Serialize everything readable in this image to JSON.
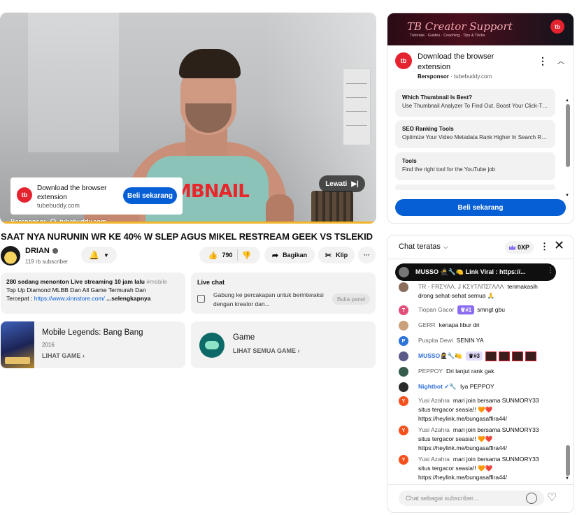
{
  "player": {
    "ad_title": "Download the browser extension",
    "ad_domain": "tubebuddy.com",
    "ad_button": "Beli sekarang",
    "ad_logo_text": "tb",
    "sponsored_label": "Bersponsor",
    "sponsored_domain": "tubebuddy.com",
    "skip_label": "Lewati",
    "tank_text": "MBNAIL",
    "progress_fraction": 1.0,
    "progress_color": "#f2b428"
  },
  "video": {
    "title": "SAAT NYA NURUNIN WR KE 40% W SLEP AGUS MIKEL RESTREAM GEEK VS TSLEKID",
    "channel_name": "DRIAN",
    "subscribers": "119 rb subscriber",
    "like_count": "790",
    "share_label": "Bagikan",
    "clip_label": "Klip",
    "more_label": "···"
  },
  "description": {
    "meta": "280 sedang menonton  Live streaming 10 jam lalu  ",
    "tag": "#mobile",
    "line2": "Top Up Diamond MLBB Dan All Game Termurah Dan",
    "line3_prefix": "Tercepat : ",
    "link": "https://www.xinnstore.com/",
    "more": "...selengkapnya"
  },
  "livechat_card": {
    "title": "Live chat",
    "text": "Gabung ke percakapan untuk berinteraksi dengan kreator dan...",
    "button": "Buka panel"
  },
  "game_card": {
    "name": "Mobile Legends: Bang Bang",
    "year": "2016",
    "link": "LIHAT GAME"
  },
  "category_card": {
    "name": "Game",
    "link": "LIHAT SEMUA GAME"
  },
  "ad_panel": {
    "banner_title": "TB Creator Support",
    "banner_sub": "Tutorials · Guides · Coaching · Tips & Tricks",
    "banner_badge": "tb",
    "logo_text": "tb",
    "title": "Download the browser extension",
    "sponsor": "Bersponsor",
    "domain": " · tubebuddy.com",
    "sitelinks": [
      {
        "title": "Which Thumbnail Is Best?",
        "desc": "Use Thumbnail Analyzer To Find Out. Boost Your Click-Th..."
      },
      {
        "title": "SEO Ranking Tools",
        "desc": "Optimize Your Video Metadata Rank Higher In Search Re..."
      },
      {
        "title": "Tools",
        "desc": "Find the right tool for the YouTube job"
      }
    ],
    "cta": "Beli sekarang"
  },
  "chat": {
    "title": "Chat teratas",
    "xp": "0XP",
    "pinned": "MUSSO 🥷🔧🍋   Link Viral : https://...",
    "messages": [
      {
        "author": "TR - FRΣΥΛΛ. J KΣΥΤΛΠΣΓΛΛΛ",
        "text": "terimakasih drong sehat-sehat semua 🙏",
        "avatar_color": "#8a6d5a",
        "avatar_letter": ""
      },
      {
        "author": "Tiopan Gacor",
        "badge": "#1",
        "text": "smngt gbu",
        "avatar_color": "#e24f7a",
        "avatar_letter": "T"
      },
      {
        "author": "GERR",
        "text": "kenapa libur dri",
        "avatar_color": "#c9a27c",
        "avatar_letter": ""
      },
      {
        "author": "Puspita Dewi",
        "text": "SENIN YA",
        "avatar_color": "#2e74d6",
        "avatar_letter": "P"
      },
      {
        "author": "MUSSO🥷🔧🍋",
        "badge": "#3",
        "text": "",
        "avatar_color": "#5b5b8a",
        "avatar_letter": ""
      },
      {
        "author": "PEPPOY",
        "text": "Dri lanjut rank gak",
        "avatar_color": "#355c4c",
        "avatar_letter": ""
      },
      {
        "author": "Nightbot ✓🔧",
        "text": "Iya PEPPOY",
        "avatar_color": "#2a2a2a",
        "avatar_letter": ""
      },
      {
        "author": "Yusi Azahra",
        "text": "mari join bersama SUNMORY33 situs tergacor seasia!! 🧡❤️ https://heylink.me/bungasaffira44/",
        "avatar_color": "#f4511e",
        "avatar_letter": "Y"
      },
      {
        "author": "Yusi Azahra",
        "text": "mari join bersama SUNMORY33 situs tergacor seasia!! 🧡❤️ https://heylink.me/bungasaffira44/",
        "avatar_color": "#f4511e",
        "avatar_letter": "Y"
      },
      {
        "author": "Yusi Azahra",
        "text": "mari join bersama SUNMORY33 situs tergacor seasia!! 🧡❤️ https://heylink.me/bungasaffira44/",
        "avatar_color": "#f4511e",
        "avatar_letter": "Y"
      }
    ],
    "input_placeholder": "Chat sebagai subscriber..."
  },
  "colors": {
    "accent_blue": "#065fd4",
    "tubebuddy_red": "#e5232f",
    "member_purple": "#8b6cf0"
  }
}
